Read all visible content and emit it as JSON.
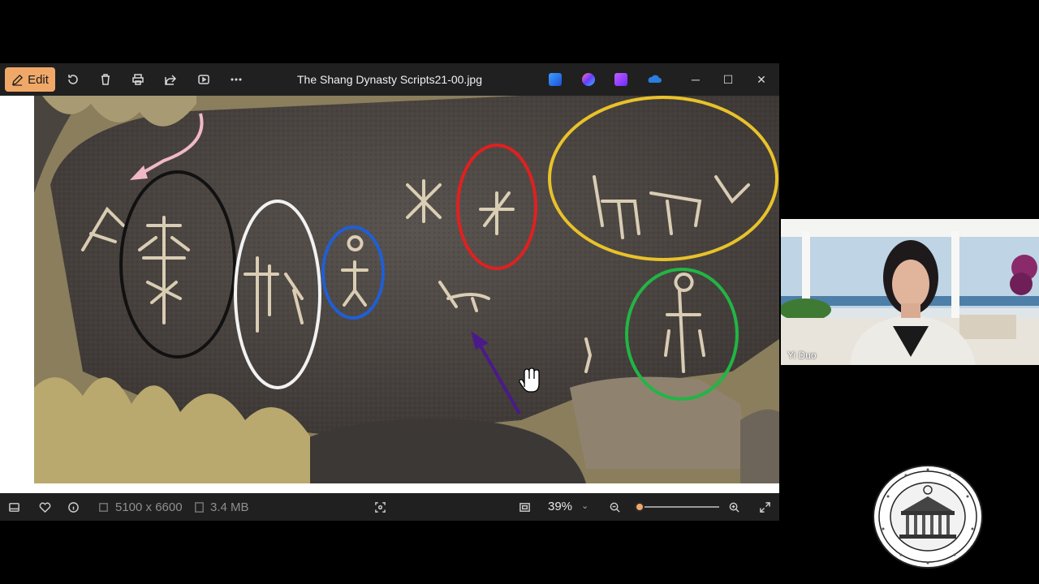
{
  "window": {
    "title": "The Shang Dynasty Scripts21-00.jpg",
    "edit_label": "Edit",
    "toolbar_icons": [
      "rotate-icon",
      "delete-icon",
      "print-icon",
      "share-icon",
      "slideshow-icon",
      "more-icon"
    ],
    "app_icons": [
      "designer-icon",
      "copilot-icon",
      "clipchamp-icon",
      "onedrive-icon"
    ],
    "controls": {
      "minimize": "─",
      "maximize": "☐",
      "close": "✕"
    }
  },
  "statusbar": {
    "dimensions": "5100 x 6600",
    "file_size": "3.4 MB",
    "zoom": "39%",
    "zoom_level": 0.06
  },
  "participant": {
    "name": "Yi Duo"
  },
  "colors": {
    "accent": "#f0a868",
    "circle_black": "#111111",
    "circle_white": "#f2f2f2",
    "circle_blue": "#1f5fd6",
    "circle_red": "#e02020",
    "circle_yellow": "#e8c22a",
    "circle_green": "#22b545",
    "arrow_pink": "#f0b8c8",
    "arrow_purple": "#4a1a8a"
  }
}
